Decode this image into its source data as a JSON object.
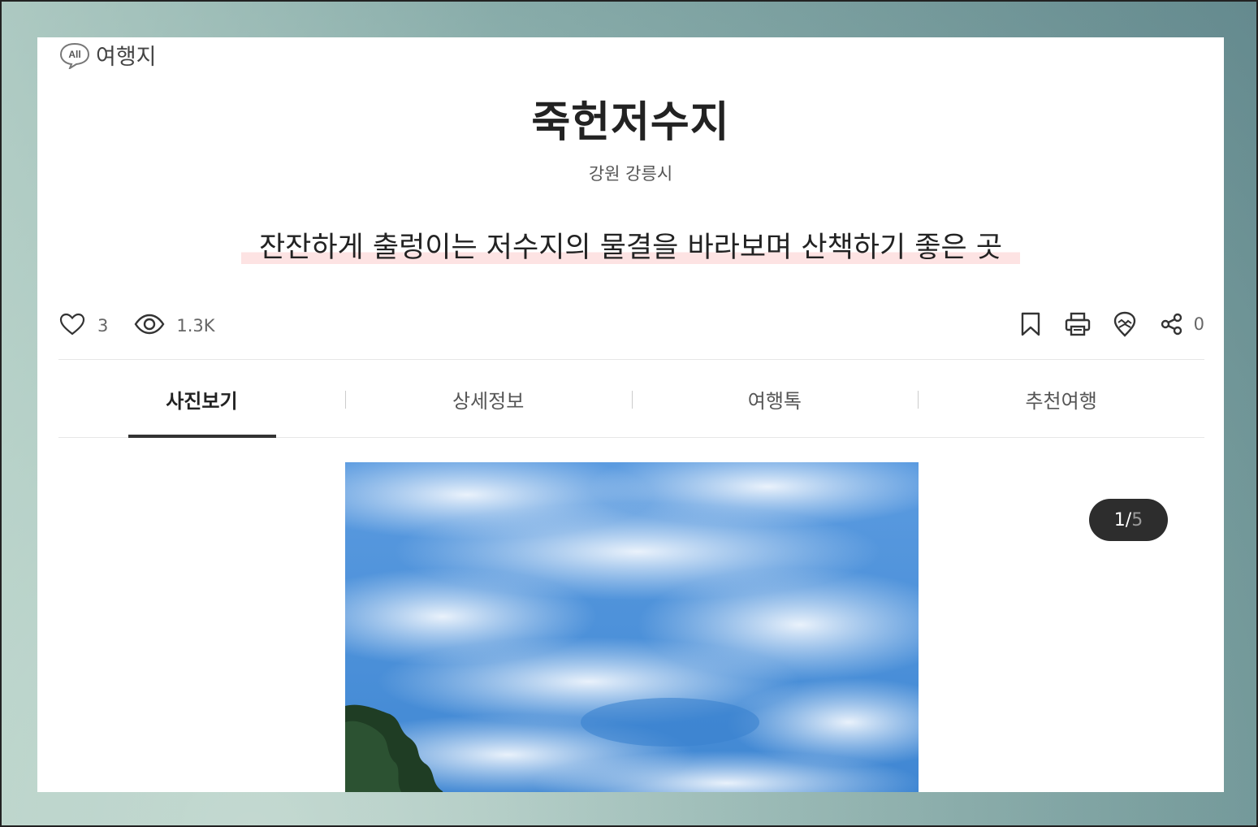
{
  "category": {
    "badge": "All",
    "label": "여행지"
  },
  "title": "죽헌저수지",
  "region": "강원 강릉시",
  "tagline": "잔잔하게 출렁이는 저수지의 물결을 바라보며 산책하기 좋은 곳",
  "stats": {
    "likes": "3",
    "views": "1.3K"
  },
  "actions": {
    "share_count": "0",
    "icons": [
      "bookmark-icon",
      "print-icon",
      "map-pin-icon",
      "share-icon"
    ]
  },
  "tabs": [
    {
      "label": "사진보기",
      "active": true
    },
    {
      "label": "상세정보",
      "active": false
    },
    {
      "label": "여행톡",
      "active": false
    },
    {
      "label": "추천여행",
      "active": false
    }
  ],
  "gallery": {
    "current": "1",
    "separator": "/",
    "total": "5"
  }
}
